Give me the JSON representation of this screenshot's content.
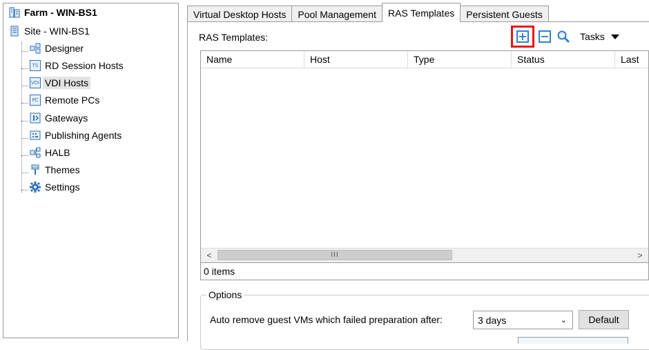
{
  "tree": {
    "farm": "Farm - WIN-BS1",
    "site": "Site - WIN-BS1",
    "items": [
      {
        "label": "Designer",
        "icon": "designer-icon"
      },
      {
        "label": "RD Session Hosts",
        "icon": "ts-icon"
      },
      {
        "label": "VDI Hosts",
        "icon": "vdi-icon"
      },
      {
        "label": "Remote PCs",
        "icon": "pc-icon"
      },
      {
        "label": "Gateways",
        "icon": "gateway-icon"
      },
      {
        "label": "Publishing Agents",
        "icon": "publishing-agent-icon"
      },
      {
        "label": "HALB",
        "icon": "halb-icon"
      },
      {
        "label": "Themes",
        "icon": "themes-icon"
      },
      {
        "label": "Settings",
        "icon": "gear-icon"
      }
    ],
    "icon_text": {
      "ts": "TS",
      "vdi": "VDI",
      "pc": "PC"
    }
  },
  "tabs": [
    "Virtual Desktop Hosts",
    "Pool Management",
    "RAS Templates",
    "Persistent Guests"
  ],
  "active_tab": "RAS Templates",
  "panel": {
    "title": "RAS Templates:",
    "tasks_label": "Tasks",
    "columns": [
      "Name",
      "Host",
      "Type",
      "Status",
      "Last"
    ],
    "scroll_thumb": "III",
    "status": "0 items"
  },
  "options": {
    "title": "Options",
    "auto_remove_label": "Auto remove guest VMs which failed preparation after:",
    "selected_value": "3 days",
    "default_button": "Default"
  },
  "colors": {
    "accent": "#2f7fd0",
    "highlight": "#ee1111"
  }
}
